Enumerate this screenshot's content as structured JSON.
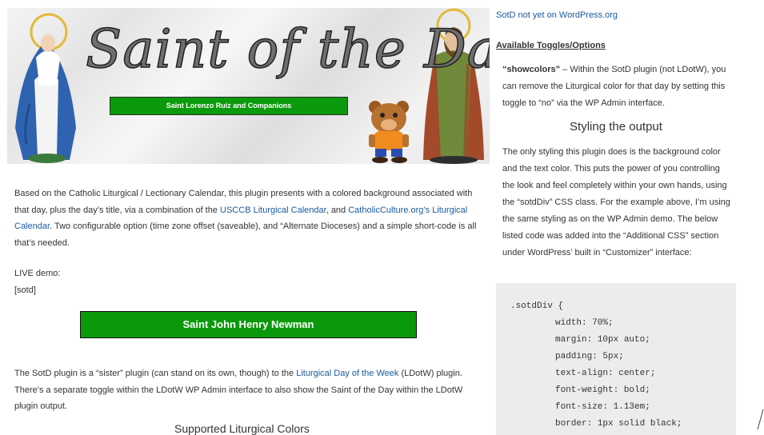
{
  "banner": {
    "title": "Saint of the Day",
    "saint_name": "Saint Lorenzo Ruiz and Companions"
  },
  "intro": {
    "p1_a": "Based on the Catholic Liturgical / Lectionary Calendar, this plugin presents with a colored background associated with that day, plus the day’s title, via a combination of the ",
    "p1_link1": "USCCB Liturgical Calendar",
    "p1_b": ", and ",
    "p1_link2": "CatholicCulture.org’s Liturgical Calendar",
    "p1_c": ". Two configurable option (time zone offset (saveable), and “Alternate Dioceses) and a simple short-code is all that’s needed.",
    "live_demo_label": "LIVE demo:",
    "shortcode": "[sotd]"
  },
  "demo_output": {
    "saint_name": "Saint John Henry Newman",
    "bg_color": "#0a990a",
    "text_color": "#ffffff"
  },
  "sister": {
    "p_a": "The SotD plugin is a “sister” plugin (can stand on its own, though) to the ",
    "p_link": "Liturgical Day of the Week",
    "p_b": " (LDotW) plugin. There’s a separate toggle within the LDotW WP Admin interface to also show the Saint of the Day within the LDotW plugin output.",
    "next_heading": "Supported Liturgical Colors"
  },
  "sidebar": {
    "wp_link": "SotD not yet on WordPress.org",
    "toggles_heading": "Available Toggles/Options",
    "showcolors_name": "“showcolors”",
    "showcolors_text": " – Within the SotD plugin (not LDotW), you can remove the Liturgical color for that day by setting this toggle to “no” via the WP Admin interface.",
    "styling_title": "Styling the output",
    "styling_text": "The only styling this plugin does is the background color and the text color. This puts the power of you controlling the look and feel completely within your own hands, using the “sotdDiv” CSS class. For the example above, I’m using the same styling as on the WP Admin demo. The below listed code was added into the “Additional CSS” section under WordPress’ built in “Customizer” interface:",
    "code": {
      "selector": ".sotdDiv {",
      "rules": [
        "width: 70%;",
        "margin: 10px auto;",
        "padding: 5px;",
        "text-align: center;",
        "font-weight: bold;",
        "font-size: 1.13em;",
        "border: 1px solid black;"
      ]
    }
  },
  "colors": {
    "link": "#1a5a9e",
    "green": "#0a990a",
    "code_bg": "#ececec"
  }
}
